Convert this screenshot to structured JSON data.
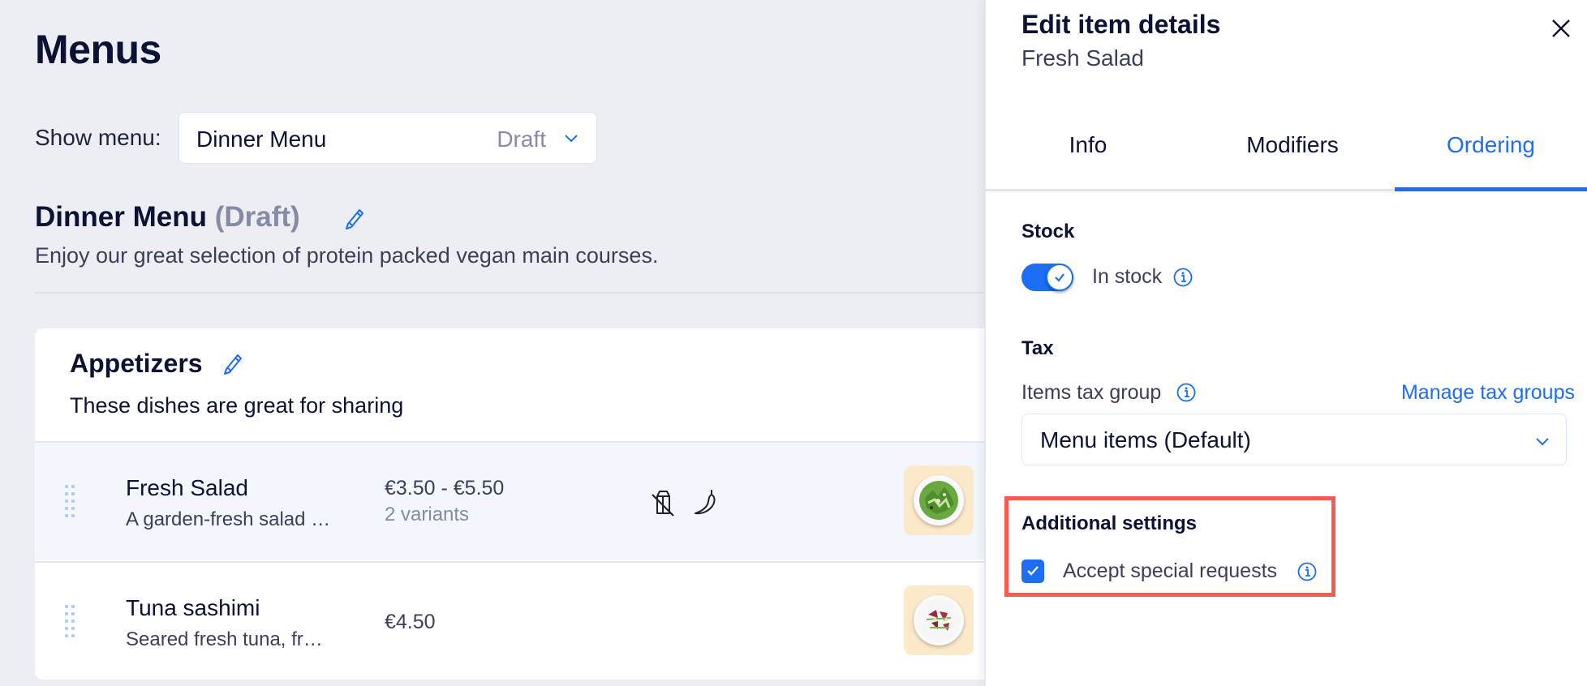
{
  "main": {
    "title": "Menus",
    "show_menu_label": "Show menu:",
    "menu_select": {
      "value": "Dinner Menu",
      "status": "Draft"
    },
    "menu": {
      "name": "Dinner Menu",
      "status": "(Draft)",
      "description": "Enjoy our great selection of protein packed vegan main courses."
    },
    "section": {
      "title": "Appetizers",
      "description": "These dishes are great for sharing",
      "items": [
        {
          "name": "Fresh Salad",
          "description": "A garden-fresh salad …",
          "price": "€3.50 - €5.50",
          "variants": "2 variants",
          "dietary_icons": [
            "dairy-free-icon",
            "spicy-icon"
          ],
          "selected": true
        },
        {
          "name": "Tuna sashimi",
          "description": "Seared fresh tuna, fr…",
          "price": "€4.50",
          "variants": "",
          "dietary_icons": [],
          "selected": false
        }
      ]
    }
  },
  "panel": {
    "title": "Edit item details",
    "subtitle": "Fresh Salad",
    "tabs": [
      {
        "label": "Info",
        "active": false
      },
      {
        "label": "Modifiers",
        "active": false
      },
      {
        "label": "Ordering",
        "active": true
      }
    ],
    "stock": {
      "heading": "Stock",
      "toggle_label": "In stock",
      "toggle_on": true
    },
    "tax": {
      "heading": "Tax",
      "group_label": "Items tax group",
      "manage_link": "Manage tax groups",
      "selected_group": "Menu items (Default)"
    },
    "additional": {
      "heading": "Additional settings",
      "checkbox_label": "Accept special requests",
      "checked": true
    }
  },
  "colors": {
    "accent": "#1c6ef5",
    "highlight": "#f85a4f",
    "background": "#edeef3",
    "selected_row": "#f3f6fd"
  }
}
